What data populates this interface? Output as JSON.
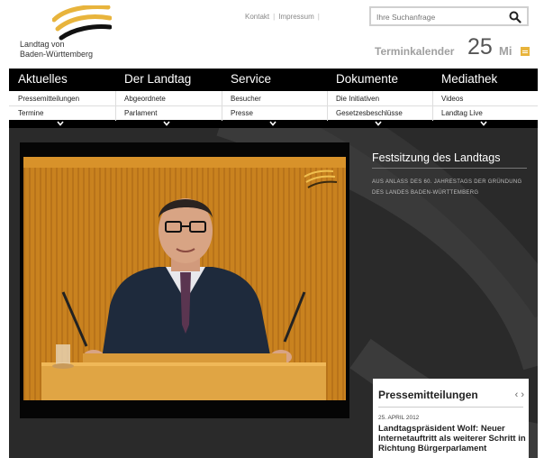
{
  "brand": {
    "name_line1": "Landtag von",
    "name_line2": "Baden-Württemberg",
    "color_gold": "#e8b43c",
    "color_dark": "#000000"
  },
  "toplinks": {
    "kontakt": "Kontakt",
    "impressum": "Impressum"
  },
  "search": {
    "placeholder": "Ihre Suchanfrage",
    "icon": "search-icon"
  },
  "termin": {
    "label": "Terminkalender",
    "day": "25",
    "weekday": "Mi",
    "icon": "calendar-icon"
  },
  "nav": {
    "items": [
      {
        "label": "Aktuelles",
        "sub1": "Pressemitteilungen",
        "sub2": "Termine"
      },
      {
        "label": "Der Landtag",
        "sub1": "Abgeordnete",
        "sub2": "Parlament"
      },
      {
        "label": "Service",
        "sub1": "Besucher",
        "sub2": "Presse"
      },
      {
        "label": "Dokumente",
        "sub1": "Die Initiativen",
        "sub2": "Gesetzesbeschlüsse"
      },
      {
        "label": "Mediathek",
        "sub1": "Videos",
        "sub2": "Landtag Live"
      }
    ]
  },
  "feature": {
    "title": "Festsitzung des Landtags",
    "subtitle": "AUS ANLASS DES 60. JAHRESTAGS DER GRÜNDUNG DES LANDES BADEN-WÜRTTEMBERG"
  },
  "press": {
    "title": "Pressemitteilungen",
    "prev": "‹",
    "next": "›",
    "date": "25. APRIL 2012",
    "headline": "Landtagspräsident Wolf: Neuer Internetauftritt als weiterer Schritt in Richtung Bürgerparlament"
  }
}
